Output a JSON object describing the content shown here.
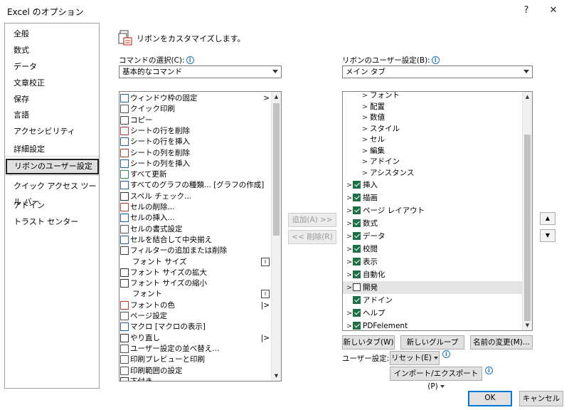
{
  "window": {
    "title": "Excel のオプション",
    "help": "?",
    "close": "✕"
  },
  "nav": {
    "items": [
      {
        "label": "全般"
      },
      {
        "label": "数式"
      },
      {
        "label": "データ"
      },
      {
        "label": "文章校正"
      },
      {
        "label": "保存"
      },
      {
        "label": "言語"
      },
      {
        "label": "アクセシビリティ"
      },
      {
        "label": "詳細設定"
      },
      {
        "label": "リボンのユーザー設定"
      },
      {
        "label": "クイック アクセス ツール バー"
      },
      {
        "label": "アドイン"
      },
      {
        "label": "トラスト センター"
      }
    ],
    "selected": "リボンのユーザー設定"
  },
  "header": {
    "text": "リボンをカスタマイズします。"
  },
  "commands": {
    "label": "コマンドの選択(C):",
    "selected": "基本的なコマンド",
    "items": [
      {
        "label": "ウィンドウ枠の固定",
        "sub": ">"
      },
      {
        "label": "クイック印刷"
      },
      {
        "label": "コピー"
      },
      {
        "label": "シートの行を削除"
      },
      {
        "label": "シートの行を挿入"
      },
      {
        "label": "シートの列を削除"
      },
      {
        "label": "シートの列を挿入"
      },
      {
        "label": "すべて更新"
      },
      {
        "label": "すべてのグラフの種類... [グラフの作成]"
      },
      {
        "label": "スペル チェック..."
      },
      {
        "label": "セルの削除..."
      },
      {
        "label": "セルの挿入..."
      },
      {
        "label": "セルの書式設定"
      },
      {
        "label": "セルを結合して中央揃え"
      },
      {
        "label": "フィルターの追加または削除"
      },
      {
        "label": "フォント サイズ",
        "sub": "combo"
      },
      {
        "label": "フォント サイズの拡大"
      },
      {
        "label": "フォント サイズの縮小"
      },
      {
        "label": "フォント",
        "sub": "combo"
      },
      {
        "label": "フォントの色",
        "sub": "|>"
      },
      {
        "label": "ページ設定"
      },
      {
        "label": "マクロ [マクロの表示]"
      },
      {
        "label": "やり直し",
        "sub": "|>"
      },
      {
        "label": "ユーザー設定の並べ替え..."
      },
      {
        "label": "印刷プレビューと印刷"
      },
      {
        "label": "印刷範囲の設定"
      },
      {
        "label": "下付き"
      }
    ]
  },
  "middle": {
    "add": "追加(A) >>",
    "remove": "<< 削除(R)"
  },
  "ribbon": {
    "label": "リボンのユーザー設定(B):",
    "selected": "メイン タブ",
    "tree": [
      {
        "label": "フォント",
        "level": 2,
        "expander": true
      },
      {
        "label": "配置",
        "level": 2,
        "expander": true
      },
      {
        "label": "数値",
        "level": 2,
        "expander": true
      },
      {
        "label": "スタイル",
        "level": 2,
        "expander": true
      },
      {
        "label": "セル",
        "level": 2,
        "expander": true
      },
      {
        "label": "編集",
        "level": 2,
        "expander": true
      },
      {
        "label": "アドイン",
        "level": 2,
        "expander": true
      },
      {
        "label": "アシスタンス",
        "level": 2,
        "expander": true
      },
      {
        "label": "挿入",
        "level": 1,
        "expander": true,
        "checked": true
      },
      {
        "label": "描画",
        "level": 1,
        "expander": true,
        "checked": true
      },
      {
        "label": "ページ レイアウト",
        "level": 1,
        "expander": true,
        "checked": true
      },
      {
        "label": "数式",
        "level": 1,
        "expander": true,
        "checked": true
      },
      {
        "label": "データ",
        "level": 1,
        "expander": true,
        "checked": true
      },
      {
        "label": "校閲",
        "level": 1,
        "expander": true,
        "checked": true
      },
      {
        "label": "表示",
        "level": 1,
        "expander": true,
        "checked": true
      },
      {
        "label": "自動化",
        "level": 1,
        "expander": true,
        "checked": true
      },
      {
        "label": "開発",
        "level": 1,
        "expander": true,
        "checked": false,
        "highlight": true
      },
      {
        "label": "アドイン",
        "level": 1,
        "expander": false,
        "checked": true
      },
      {
        "label": "ヘルプ",
        "level": 1,
        "expander": true,
        "checked": true
      },
      {
        "label": "PDFelement",
        "level": 1,
        "expander": true,
        "checked": true
      }
    ],
    "new_tab": "新しいタブ(W)",
    "new_group": "新しいグループ(N)",
    "rename": "名前の変更(M)...",
    "custom_label": "ユーザー設定:",
    "reset": "リセット(E)",
    "import_export": "インポート/エクスポート(P)"
  },
  "footer": {
    "ok": "OK",
    "cancel": "キャンセル"
  },
  "colors": {
    "check": "#1e7145",
    "accent": "#0078d7",
    "info": "#1a73c8"
  }
}
